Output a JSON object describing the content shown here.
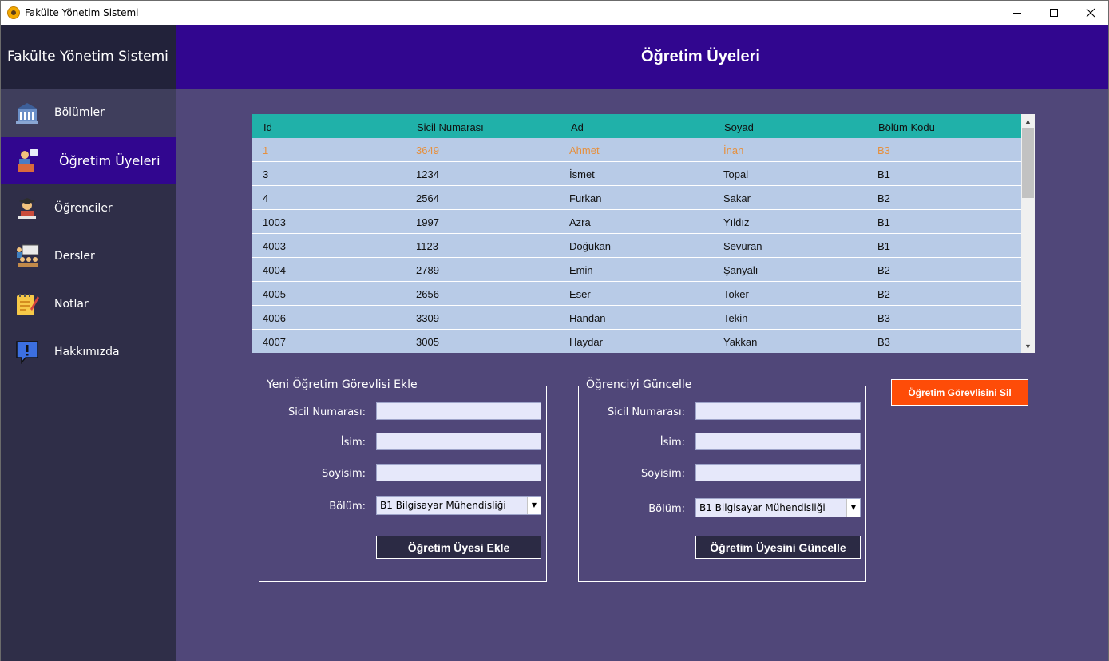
{
  "window": {
    "title": "Fakülte Yönetim Sistemi"
  },
  "sidebar": {
    "brand": "Fakülte Yönetim Sistemi",
    "items": [
      {
        "label": "Bölümler",
        "icon": "building-icon"
      },
      {
        "label": "Öğretim Üyeleri",
        "icon": "lecturer-icon"
      },
      {
        "label": "Öğrenciler",
        "icon": "student-icon"
      },
      {
        "label": "Dersler",
        "icon": "classroom-icon"
      },
      {
        "label": "Notlar",
        "icon": "notepad-icon"
      },
      {
        "label": "Hakkımızda",
        "icon": "info-bubble-icon"
      }
    ]
  },
  "header": {
    "title": "Öğretim Üyeleri"
  },
  "table": {
    "columns": [
      "Id",
      "Sicil Numarası",
      "Ad",
      "Soyad",
      "Bölüm Kodu"
    ],
    "rows": [
      [
        "1",
        "3649",
        "Ahmet",
        "İnan",
        "B3"
      ],
      [
        "3",
        "1234",
        "İsmet",
        "Topal",
        "B1"
      ],
      [
        "4",
        "2564",
        "Furkan",
        "Sakar",
        "B2"
      ],
      [
        "1003",
        "1997",
        "Azra",
        "Yıldız",
        "B1"
      ],
      [
        "4003",
        "1123",
        "Doğukan",
        "Sevüran",
        "B1"
      ],
      [
        "4004",
        "2789",
        "Emin",
        "Şanyalı",
        "B2"
      ],
      [
        "4005",
        "2656",
        "Eser",
        "Toker",
        "B2"
      ],
      [
        "4006",
        "3309",
        "Handan",
        "Tekin",
        "B3"
      ],
      [
        "4007",
        "3005",
        "Haydar",
        "Yakkan",
        "B3"
      ]
    ]
  },
  "add_form": {
    "title": "Yeni Öğretim Görevlisi Ekle",
    "sicil_label": "Sicil Numarası:",
    "isim_label": "İsim:",
    "soyisim_label": "Soyisim:",
    "bolum_label": "Bölüm:",
    "bolum_value": "B1 Bilgisayar Mühendisliği",
    "submit": "Öğretim Üyesi Ekle"
  },
  "update_form": {
    "title": "Öğrenciyi Güncelle",
    "sicil_label": "Sicil Numarası:",
    "isim_label": "İsim:",
    "soyisim_label": "Soyisim:",
    "bolum_label": "Bölüm:",
    "bolum_value": "B1 Bilgisayar Mühendisliği",
    "submit": "Öğretim Üyesini Güncelle"
  },
  "delete_button": "Öğretim Görevlisini Sil",
  "colors": {
    "header": "#31068f",
    "sidebar": "#2f2e48",
    "main": "#504779",
    "grid_header": "#20b1a9",
    "grid_rows": "#b8cbe7",
    "selected_text": "#e6903e",
    "delete": "#fe4c08"
  }
}
